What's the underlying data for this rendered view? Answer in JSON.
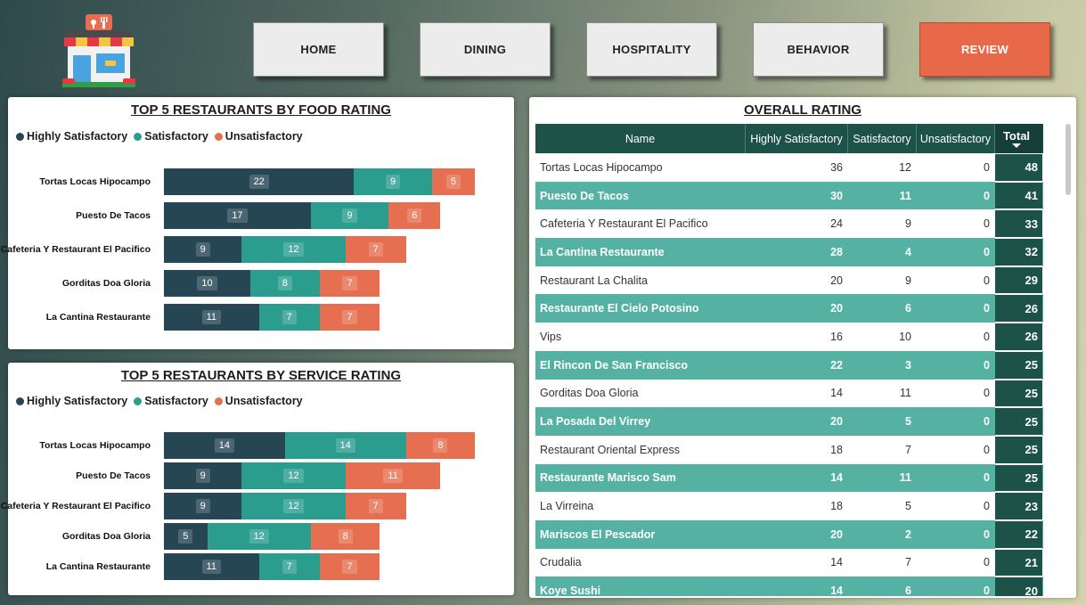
{
  "nav": {
    "home": "HOME",
    "dining": "DINING",
    "hospitality": "HOSPITALITY",
    "behavior": "BEHAVIOR",
    "review": "REVIEW",
    "active": "review",
    "logo_icon": "restaurant-storefront-icon"
  },
  "legend": {
    "highly": "Highly Satisfactory",
    "satisfactory": "Satisfactory",
    "unsatisfactory": "Unsatisfactory"
  },
  "colors": {
    "highly": "#264653",
    "satisfactory": "#2a9d8f",
    "unsatisfactory": "#e76f51",
    "table_header": "#1d5249",
    "table_alt_row": "#55b2a3",
    "active_nav": "#e8694a"
  },
  "chart_data": [
    {
      "type": "bar",
      "orientation": "horizontal",
      "stacked": true,
      "title": "TOP 5 RESTAURANTS BY FOOD RATING",
      "legend_position": "top-left",
      "categories": [
        "Tortas Locas Hipocampo",
        "Puesto De Tacos",
        "Cafeteria Y Restaurant El Pacifico",
        "Gorditas Doa Gloria",
        "La Cantina Restaurante"
      ],
      "series": [
        {
          "name": "Highly Satisfactory",
          "values": [
            22,
            17,
            9,
            10,
            11
          ]
        },
        {
          "name": "Satisfactory",
          "values": [
            9,
            9,
            12,
            8,
            7
          ]
        },
        {
          "name": "Unsatisfactory",
          "values": [
            5,
            6,
            7,
            7,
            7
          ]
        }
      ]
    },
    {
      "type": "bar",
      "orientation": "horizontal",
      "stacked": true,
      "title": "TOP 5 RESTAURANTS BY SERVICE RATING",
      "legend_position": "top-left",
      "categories": [
        "Tortas Locas Hipocampo",
        "Puesto De Tacos",
        "Cafeteria Y Restaurant El Pacifico",
        "Gorditas Doa Gloria",
        "La Cantina Restaurante"
      ],
      "series": [
        {
          "name": "Highly Satisfactory",
          "values": [
            14,
            9,
            9,
            5,
            11
          ]
        },
        {
          "name": "Satisfactory",
          "values": [
            14,
            12,
            12,
            12,
            7
          ]
        },
        {
          "name": "Unsatisfactory",
          "values": [
            8,
            11,
            7,
            8,
            7
          ]
        }
      ]
    }
  ],
  "table": {
    "title": "OVERALL RATING",
    "columns": [
      "Name",
      "Highly Satisfactory",
      "Satisfactory",
      "Unsatisfactory",
      "Total"
    ],
    "sort_column": "Total",
    "sort_direction": "descending",
    "rows": [
      [
        "Tortas Locas Hipocampo",
        "36",
        "12",
        "0",
        "48"
      ],
      [
        "Puesto De Tacos",
        "30",
        "11",
        "0",
        "41"
      ],
      [
        "Cafeteria Y Restaurant El Pacifico",
        "24",
        "9",
        "0",
        "33"
      ],
      [
        "La Cantina Restaurante",
        "28",
        "4",
        "0",
        "32"
      ],
      [
        "Restaurant La Chalita",
        "20",
        "9",
        "0",
        "29"
      ],
      [
        "Restaurante El Cielo Potosino",
        "20",
        "6",
        "0",
        "26"
      ],
      [
        "Vips",
        "16",
        "10",
        "0",
        "26"
      ],
      [
        "El Rincon De San Francisco",
        "22",
        "3",
        "0",
        "25"
      ],
      [
        "Gorditas Doa Gloria",
        "14",
        "11",
        "0",
        "25"
      ],
      [
        "La Posada Del Virrey",
        "20",
        "5",
        "0",
        "25"
      ],
      [
        "Restaurant Oriental Express",
        "18",
        "7",
        "0",
        "25"
      ],
      [
        "Restaurante Marisco Sam",
        "14",
        "11",
        "0",
        "25"
      ],
      [
        "La Virreina",
        "18",
        "5",
        "0",
        "23"
      ],
      [
        "Mariscos El Pescador",
        "20",
        "2",
        "0",
        "22"
      ],
      [
        "Crudalia",
        "14",
        "7",
        "0",
        "21"
      ],
      [
        "Koye Sushi",
        "14",
        "6",
        "0",
        "20"
      ]
    ]
  }
}
